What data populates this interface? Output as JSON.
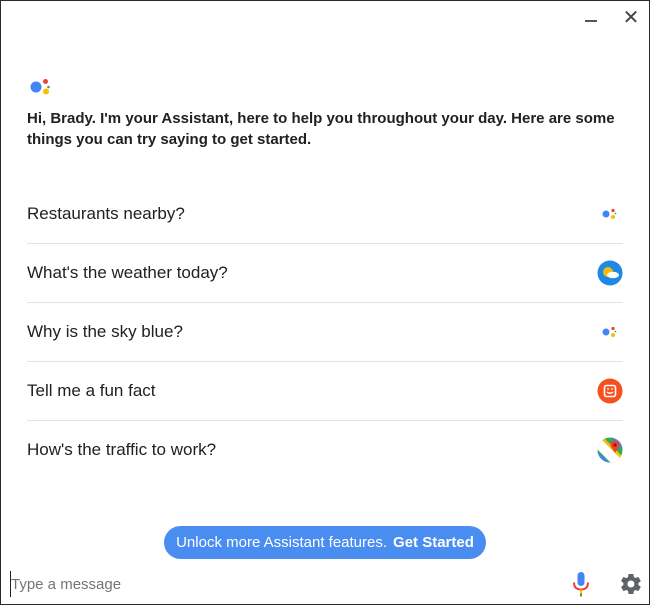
{
  "window": {
    "minimize_icon": "minimize-icon",
    "close_glyph": "✕"
  },
  "greeting": "Hi, Brady. I'm your Assistant, here to help you throughout your day. Here are some things you can try saying to get started.",
  "suggestions": [
    {
      "label": "Restaurants nearby?",
      "icon": "assistant-dots-icon"
    },
    {
      "label": "What's the weather today?",
      "icon": "weather-icon"
    },
    {
      "label": "Why is the sky blue?",
      "icon": "assistant-dots-icon"
    },
    {
      "label": "Tell me a fun fact",
      "icon": "fun-fact-icon"
    },
    {
      "label": "How's the traffic to work?",
      "icon": "maps-icon"
    }
  ],
  "unlock": {
    "text": "Unlock more Assistant features.",
    "cta": "Get Started"
  },
  "input": {
    "placeholder": "Type a message"
  },
  "colors": {
    "blue": "#4285f4",
    "red": "#ea4335",
    "yellow": "#fbbc05",
    "green": "#34a853",
    "button_bg": "#4a8df1",
    "orange": "#f4511e"
  }
}
